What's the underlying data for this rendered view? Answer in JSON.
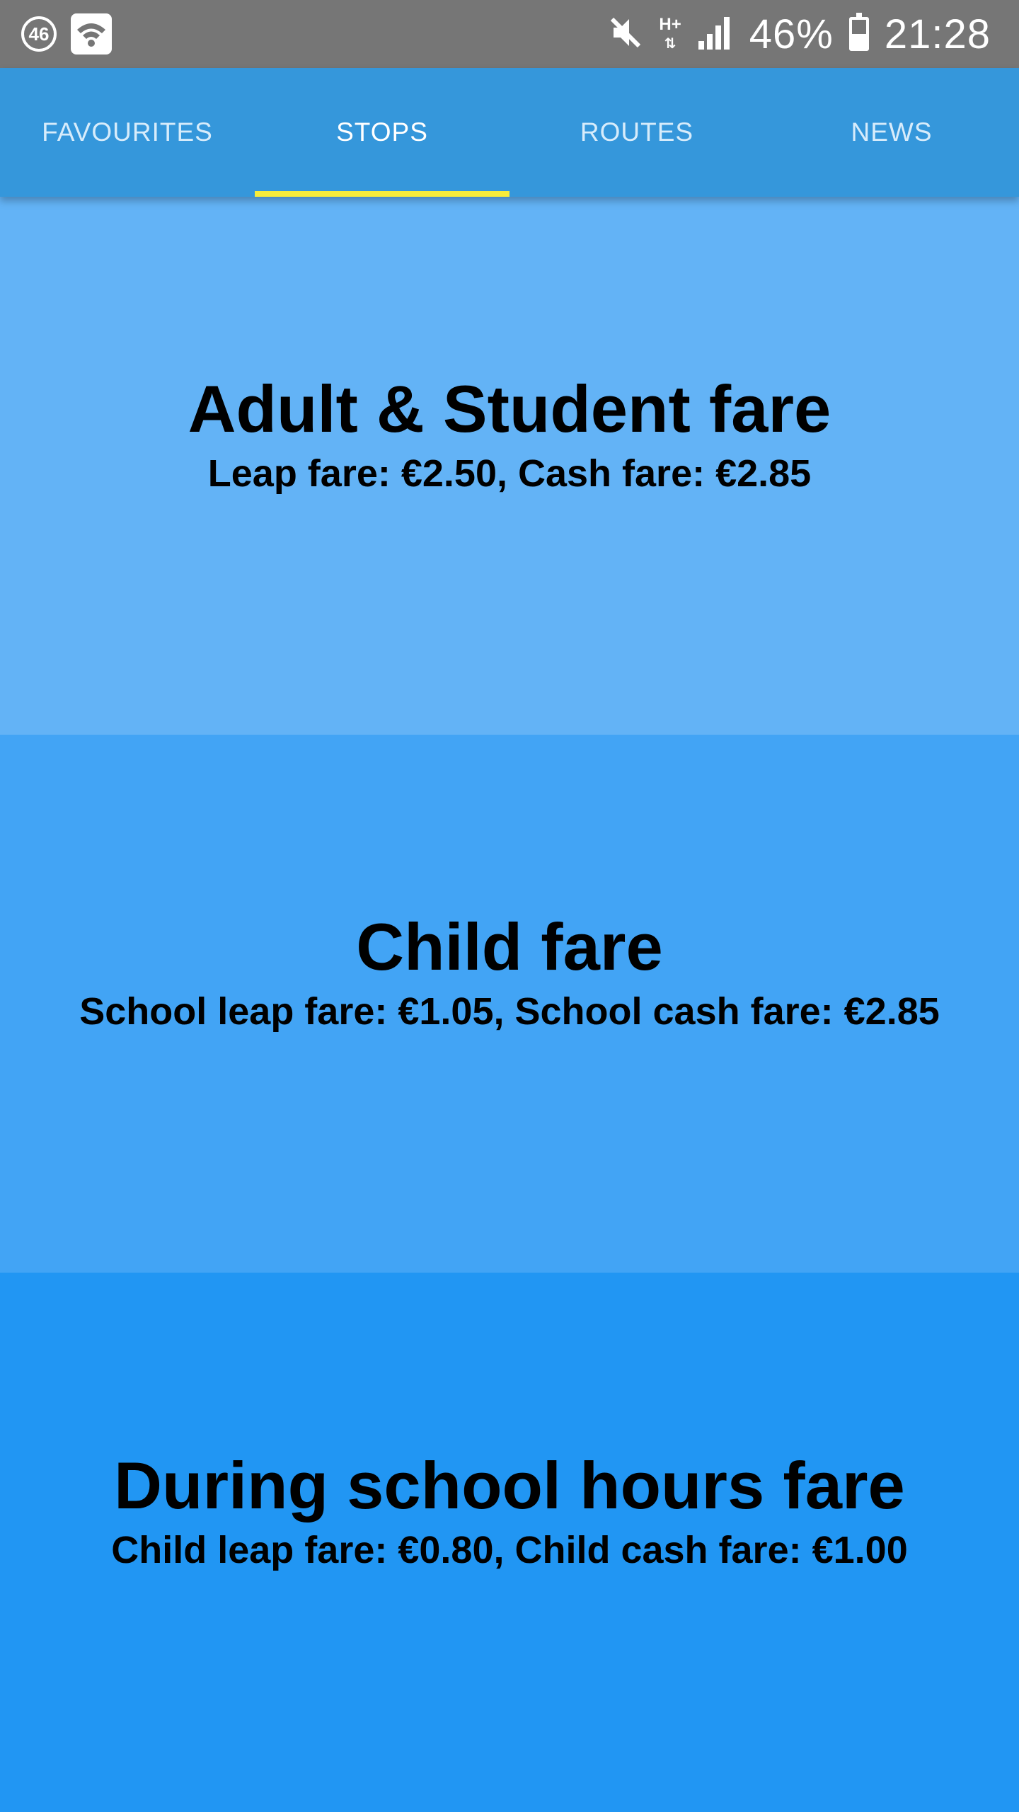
{
  "status_bar": {
    "notification_count": "46",
    "network_type": "H+",
    "battery_percent": "46%",
    "time": "21:28",
    "icons": [
      "notification-count-icon",
      "wifi-icon",
      "mute-icon",
      "network-hplus-icon",
      "signal-icon",
      "battery-icon"
    ]
  },
  "tabs": [
    {
      "label": "FAVOURITES",
      "active": false
    },
    {
      "label": "STOPS",
      "active": true
    },
    {
      "label": "ROUTES",
      "active": false
    },
    {
      "label": "NEWS",
      "active": false
    }
  ],
  "fares": [
    {
      "title": "Adult & Student fare",
      "detail": "Leap fare: €2.50, Cash fare: €2.85"
    },
    {
      "title": "Child fare",
      "detail": "School leap fare: €1.05, School cash fare: €2.85"
    },
    {
      "title": "During school hours fare",
      "detail": "Child leap fare: €0.80, Child cash fare: €1.00"
    }
  ],
  "colors": {
    "status_bar": "#767676",
    "tab_bar": "#3597DB",
    "tab_indicator": "#f7ec3a",
    "panel_1": "#63B3F6",
    "panel_2": "#42A4F5",
    "panel_3": "#2196F3"
  }
}
